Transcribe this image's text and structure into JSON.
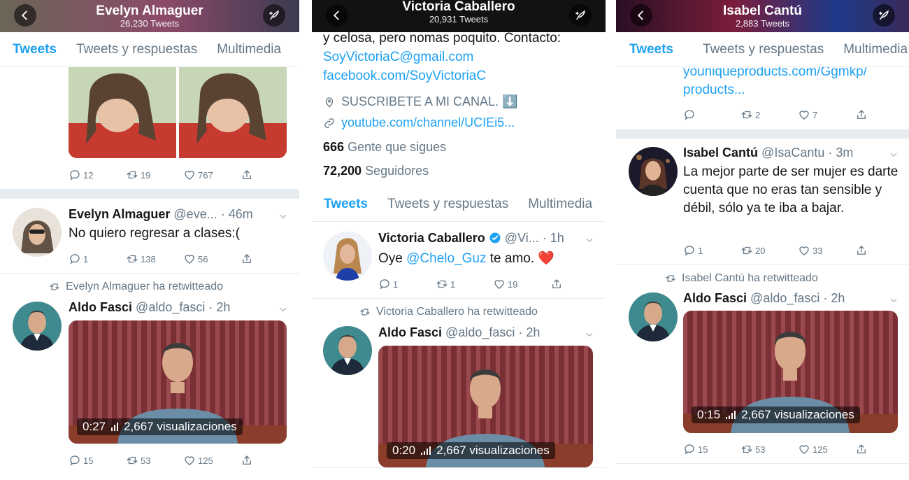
{
  "panels": [
    {
      "header": {
        "name": "Evelyn Almaguer",
        "tweets": "26,230 Tweets"
      },
      "tabs": [
        "Tweets",
        "Tweets y respuestas",
        "Multimedia"
      ],
      "photo_tweet": {
        "replies": "12",
        "retweets": "19",
        "likes": "767"
      },
      "tweet1": {
        "name": "Evelyn Almaguer",
        "handle_time": "@eve... · 46m",
        "text": "No quiero regresar a clases:(",
        "replies": "1",
        "retweets": "138",
        "likes": "56"
      },
      "retweet": {
        "by": "Evelyn Almaguer ha retwitteado",
        "name": "Aldo Fasci",
        "handle_time": "@aldo_fasci · 2h",
        "video_time": "0:27",
        "views": "2,667 visualizaciones",
        "replies": "15",
        "retweets": "53",
        "likes": "125"
      }
    },
    {
      "header": {
        "name": "Victoria Caballero",
        "tweets": "20,931 Tweets"
      },
      "bio": {
        "line1": "y celosa, pero nomas poquito. Contacto:",
        "email": "SoyVictoriaC@gmail.com",
        "facebook": "facebook.com/SoyVictoriaC"
      },
      "location": "SUSCRIBETE A MI CANAL. ⬇️",
      "url": "youtube.com/channel/UCIEi5...",
      "following_count": "666",
      "following_label": "Gente que sigues",
      "followers_count": "72,200",
      "followers_label": "Seguidores",
      "tabs": [
        "Tweets",
        "Tweets y respuestas",
        "Multimedia"
      ],
      "tweet1": {
        "name": "Victoria Caballero",
        "handle_time": "@Vi... · 1h",
        "text_pre": "Oye",
        "mention": "@Chelo_Guz",
        "text_post": "te amo. ❤️",
        "replies": "1",
        "retweets": "1",
        "likes": "19"
      },
      "retweet": {
        "by": "Victoria Caballero ha retwitteado",
        "name": "Aldo Fasci",
        "handle_time": "@aldo_fasci · 2h",
        "video_time": "0:20",
        "views": "2,667 visualizaciones"
      }
    },
    {
      "header": {
        "name": "Isabel Cantú",
        "tweets": "2,883 Tweets"
      },
      "tabs": [
        "Tweets",
        "Tweets y respuestas",
        "Multimedia"
      ],
      "top_link": {
        "line1": "youniqueproducts.com/Ggmkp/",
        "line2": "products..."
      },
      "top_actions": {
        "replies": "",
        "retweets": "2",
        "likes": "7"
      },
      "tweet1": {
        "name": "Isabel Cantú",
        "handle_time": "@IsaCantu · 3m",
        "text": "La mejor parte de ser mujer es darte cuenta que no eras tan sensible y débil, sólo ya te iba a bajar.",
        "replies": "1",
        "retweets": "20",
        "likes": "33"
      },
      "retweet": {
        "by": "Isabel Cantú ha retwitteado",
        "name": "Aldo Fasci",
        "handle_time": "@aldo_fasci · 2h",
        "video_time": "0:15",
        "views": "2,667 visualizaciones",
        "replies": "15",
        "retweets": "53",
        "likes": "125"
      }
    }
  ],
  "colors": {
    "accent": "#1da1f2",
    "muted": "#657786",
    "border": "#e6ecf0"
  }
}
